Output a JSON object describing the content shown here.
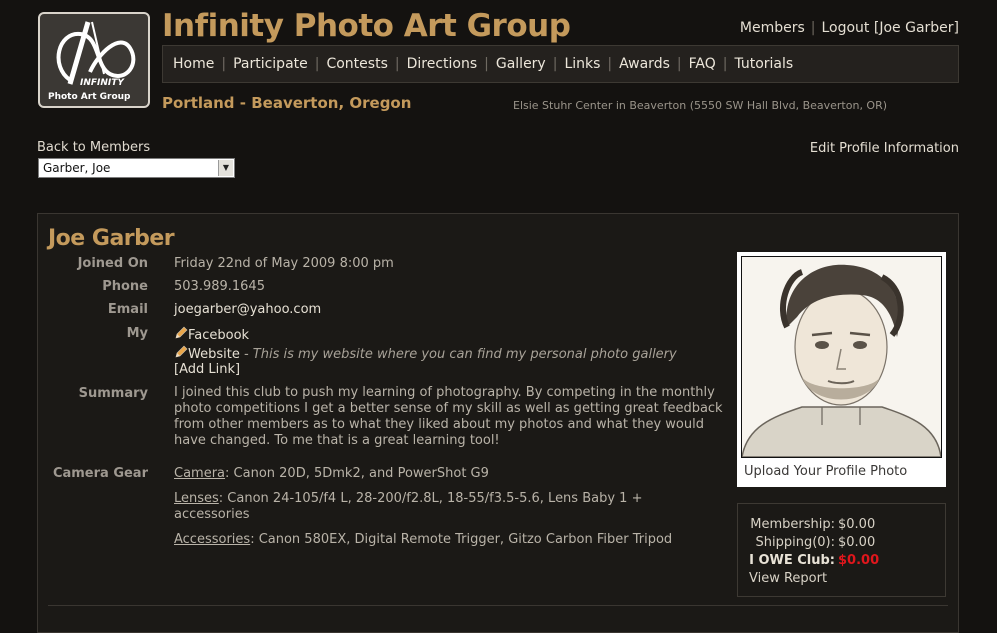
{
  "header": {
    "logo_text_line1": "INFINITY",
    "logo_text_line2": "Photo Art Group",
    "site_title": "Infinity Photo Art Group",
    "location": "Portland - Beaverton, Oregon",
    "venue": "Elsie Stuhr Center in Beaverton (5550 SW Hall Blvd, Beaverton, OR)"
  },
  "top_links": {
    "members": "Members",
    "separator": "|",
    "logout": "Logout",
    "user": "[Joe Garber]"
  },
  "nav": {
    "items": [
      "Home",
      "Participate",
      "Contests",
      "Directions",
      "Gallery",
      "Links",
      "Awards",
      "FAQ",
      "Tutorials"
    ]
  },
  "members_nav": {
    "back_label": "Back to Members",
    "selected_member": "Garber, Joe",
    "edit_profile": "Edit Profile Information"
  },
  "profile": {
    "name": "Joe Garber",
    "labels": {
      "joined": "Joined On",
      "phone": "Phone",
      "email": "Email",
      "my": "My",
      "summary": "Summary",
      "gear": "Camera Gear"
    },
    "joined_on": "Friday 22nd of May 2009 8:00 pm",
    "phone": "503.989.1645",
    "email": "joegarber@yahoo.com",
    "links": [
      {
        "label": "Facebook",
        "desc": ""
      },
      {
        "label": "Website",
        "desc": " - This is my website where you can find my personal photo gallery"
      }
    ],
    "add_link": "[Add Link]",
    "summary": "I joined this club to push my learning of photography. By competing in the monthly photo competitions I get a better sense of my skill as well as getting great feedback from other members as to what they liked about my photos and what they would have changed. To me that is a great learning tool!",
    "gear": [
      {
        "label": "Camera",
        "value": ": Canon 20D, 5Dmk2, and PowerShot G9"
      },
      {
        "label": "Lenses",
        "value": ": Canon 24-105/f4 L, 28-200/f2.8L, 18-55/f3.5-5.6, Lens Baby 1 + accessories"
      },
      {
        "label": "Accessories",
        "value": ": Canon 580EX, Digital Remote Trigger, Gitzo Carbon Fiber Tripod"
      }
    ],
    "upload_photo": "Upload Your Profile Photo"
  },
  "account": {
    "membership_label": "Membership:",
    "membership_value": "$0.00",
    "shipping_label": "Shipping(0):",
    "shipping_value": "$0.00",
    "owe_label": "I OWE Club:",
    "owe_value": "$0.00",
    "view_report": "View Report"
  },
  "colors": {
    "accent": "#c49a5c",
    "background": "#141210",
    "owe_red": "#e0161c"
  }
}
